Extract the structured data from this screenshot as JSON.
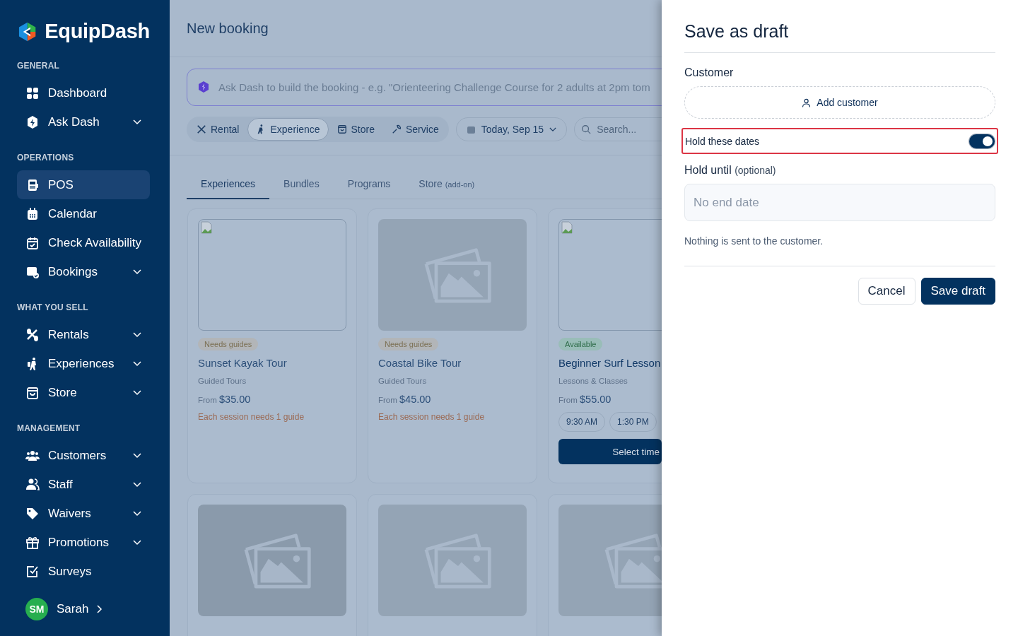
{
  "brand": {
    "name": "EquipDash"
  },
  "sidebar": {
    "sections": [
      {
        "title": "GENERAL",
        "items": [
          {
            "label": "Dashboard",
            "has_submenu": false,
            "selected": false
          },
          {
            "label": "Ask Dash",
            "has_submenu": true,
            "selected": false
          }
        ]
      },
      {
        "title": "OPERATIONS",
        "items": [
          {
            "label": "POS",
            "has_submenu": false,
            "selected": true
          },
          {
            "label": "Calendar",
            "has_submenu": false,
            "selected": false
          },
          {
            "label": "Check Availability",
            "has_submenu": false,
            "selected": false
          },
          {
            "label": "Bookings",
            "has_submenu": true,
            "selected": false
          }
        ]
      },
      {
        "title": "WHAT YOU SELL",
        "items": [
          {
            "label": "Rentals",
            "has_submenu": true,
            "selected": false
          },
          {
            "label": "Experiences",
            "has_submenu": true,
            "selected": false
          },
          {
            "label": "Store",
            "has_submenu": true,
            "selected": false
          }
        ]
      },
      {
        "title": "MANAGEMENT",
        "items": [
          {
            "label": "Customers",
            "has_submenu": true,
            "selected": false
          },
          {
            "label": "Staff",
            "has_submenu": true,
            "selected": false
          },
          {
            "label": "Waivers",
            "has_submenu": true,
            "selected": false
          },
          {
            "label": "Promotions",
            "has_submenu": true,
            "selected": false
          },
          {
            "label": "Surveys",
            "has_submenu": false,
            "selected": false
          }
        ]
      }
    ],
    "user": {
      "initials": "SM",
      "name": "Sarah"
    }
  },
  "page": {
    "title": "New booking",
    "prompt": {
      "placeholder": "Ask Dash to build the booking - e.g. \"Orienteering Challenge Course for 2 adults at 2pm tom"
    },
    "types": [
      {
        "label": "Rental",
        "selected": false
      },
      {
        "label": "Experience",
        "selected": true
      },
      {
        "label": "Store",
        "selected": false
      },
      {
        "label": "Service",
        "selected": false
      }
    ],
    "date": {
      "value": "Today, Sep 15"
    },
    "search": {
      "placeholder": "Search..."
    },
    "tabs": [
      {
        "label": "Experiences",
        "selected": true
      },
      {
        "label": "Bundles",
        "selected": false
      },
      {
        "label": "Programs",
        "selected": false
      },
      {
        "label": "Store",
        "note": "(add-on)",
        "selected": false
      }
    ],
    "cards": [
      {
        "kind": "broken",
        "badge": {
          "label": "Needs guides",
          "kind": "warning"
        },
        "title": "Sunset Kayak Tour",
        "category": "Guided Tours",
        "price_prefix": "From",
        "price": "$35.00",
        "note": "Each session needs 1 guide"
      },
      {
        "kind": "placeholder",
        "badge": {
          "label": "Needs guides",
          "kind": "warning"
        },
        "title": "Coastal Bike Tour",
        "category": "Guided Tours",
        "price_prefix": "From",
        "price": "$45.00",
        "note": "Each session needs 1 guide"
      },
      {
        "kind": "broken",
        "badge": {
          "label": "Available",
          "kind": "success"
        },
        "title": "Beginner Surf Lesson",
        "category": "Lessons & Classes",
        "price_prefix": "From",
        "price": "$55.00",
        "times": [
          "9:30 AM",
          "1:30 PM"
        ],
        "action": "Select time"
      },
      {
        "kind": "placeholder"
      },
      {
        "kind": "placeholder"
      },
      {
        "kind": "placeholder"
      }
    ]
  },
  "drawer": {
    "title": "Save as draft",
    "customer_label": "Customer",
    "add_customer": "Add customer",
    "hold": {
      "label": "Hold these dates",
      "on": true,
      "highlighted": true
    },
    "hold_until": {
      "label": "Hold until",
      "hint": "(optional)",
      "placeholder": "No end date"
    },
    "note": "Nothing is sent to the customer.",
    "buttons": [
      {
        "label": "Cancel",
        "kind": "secondary"
      },
      {
        "label": "Save draft",
        "kind": "primary"
      }
    ]
  }
}
